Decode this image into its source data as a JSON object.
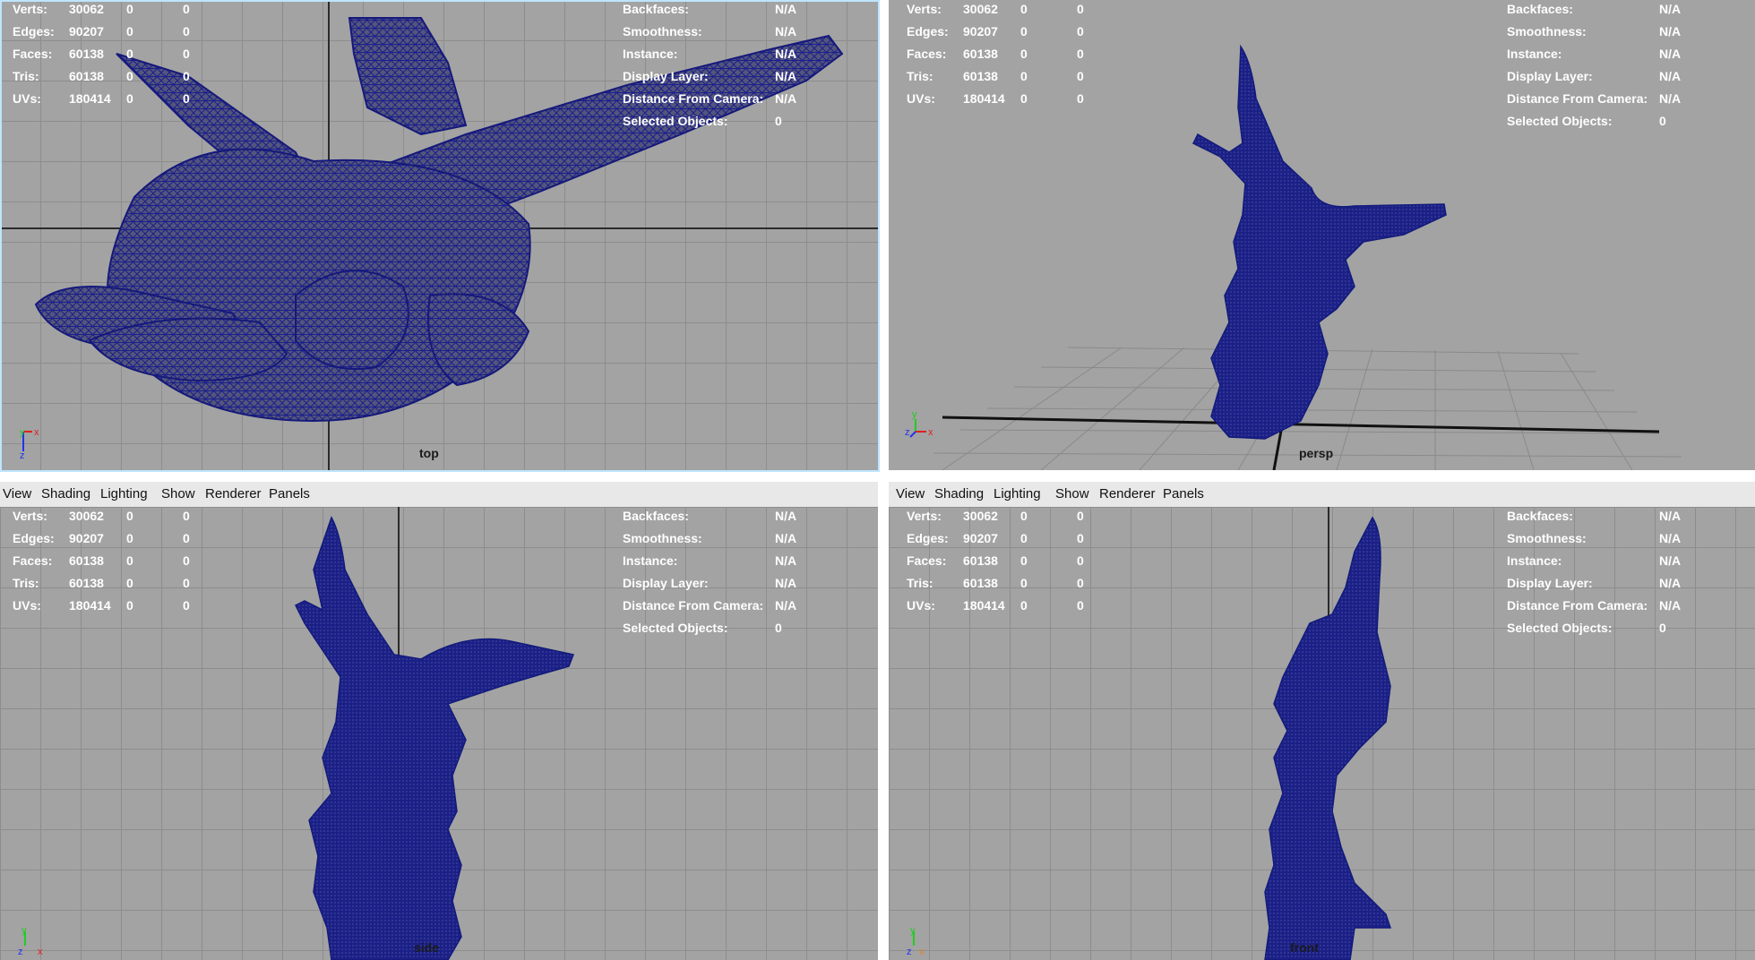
{
  "menu": [
    "View",
    "Shading",
    "Lighting",
    "Show",
    "Renderer",
    "Panels"
  ],
  "hud_left": [
    {
      "label": "Verts:",
      "v1": "30062",
      "v2": "0",
      "v3": "0"
    },
    {
      "label": "Edges:",
      "v1": "90207",
      "v2": "0",
      "v3": "0"
    },
    {
      "label": "Faces:",
      "v1": "60138",
      "v2": "0",
      "v3": "0"
    },
    {
      "label": "Tris:",
      "v1": "60138",
      "v2": "0",
      "v3": "0"
    },
    {
      "label": "UVs:",
      "v1": "180414",
      "v2": "0",
      "v3": "0"
    }
  ],
  "hud_right": [
    {
      "label": "Backfaces:",
      "value": "N/A"
    },
    {
      "label": "Smoothness:",
      "value": "N/A"
    },
    {
      "label": "Instance:",
      "value": "N/A"
    },
    {
      "label": "Display Layer:",
      "value": "N/A"
    },
    {
      "label": "Distance From Camera:",
      "value": "N/A"
    },
    {
      "label": "Selected Objects:",
      "value": "0"
    }
  ],
  "panels": {
    "top": {
      "camera": "top"
    },
    "persp": {
      "camera": "persp"
    },
    "side": {
      "camera": "side"
    },
    "front": {
      "camera": "front"
    }
  },
  "axis": {
    "x": "x",
    "y": "y",
    "z": "z"
  },
  "colors": {
    "mesh": "#1a1f8a",
    "hud_text": "#ffffff",
    "viewport_bg": "#a3a3a3",
    "x_axis": "#e02020",
    "y_axis": "#22cc22",
    "z_axis": "#2233ee"
  }
}
